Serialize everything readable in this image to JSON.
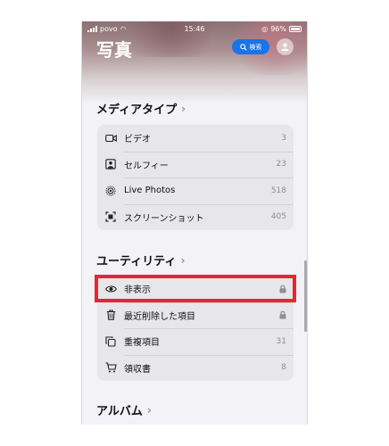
{
  "status_bar": {
    "carrier": "povo",
    "time": "15:46",
    "battery": "96%"
  },
  "header": {
    "title": "写真",
    "search_label": "検索"
  },
  "sections": {
    "media_types": {
      "title": "メディアタイプ",
      "items": [
        {
          "label": "ビデオ",
          "count": "3",
          "icon": "video-icon"
        },
        {
          "label": "セルフィー",
          "count": "23",
          "icon": "selfie-icon"
        },
        {
          "label": "Live Photos",
          "count": "518",
          "icon": "live-photos-icon"
        },
        {
          "label": "スクリーンショット",
          "count": "405",
          "icon": "screenshot-icon"
        }
      ]
    },
    "utilities": {
      "title": "ユーティリティ",
      "items": [
        {
          "label": "非表示",
          "icon": "eye-icon",
          "locked": true
        },
        {
          "label": "最近削除した項目",
          "icon": "trash-icon",
          "locked": true
        },
        {
          "label": "重複項目",
          "count": "31",
          "icon": "duplicate-icon"
        },
        {
          "label": "領収書",
          "count": "8",
          "icon": "cart-icon"
        }
      ]
    },
    "albums": {
      "title": "アルバム"
    }
  },
  "colors": {
    "accent": "#1a73e8",
    "highlight": "#e8262f",
    "group_bg": "#e6e6eb"
  }
}
